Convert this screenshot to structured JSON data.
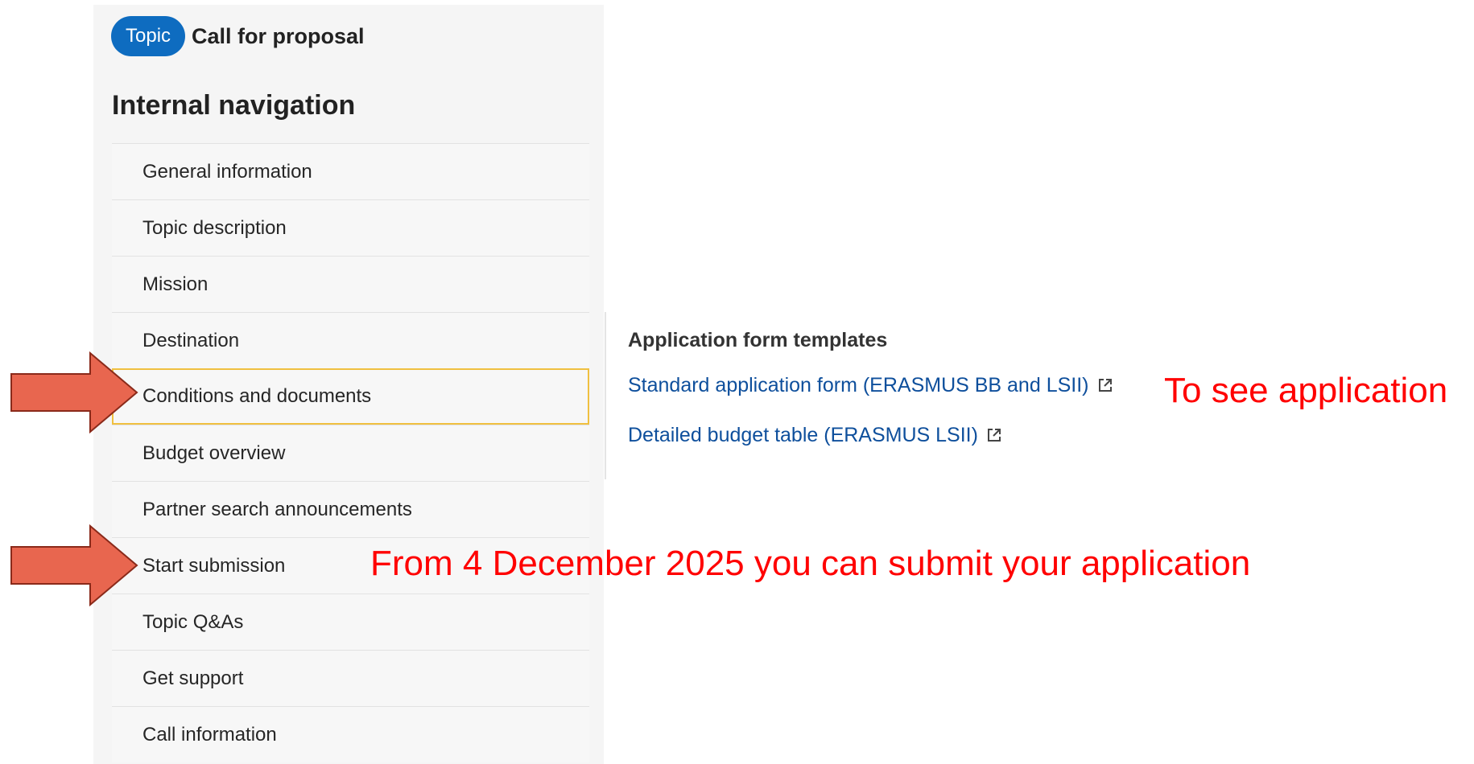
{
  "header": {
    "topic_badge": "Topic",
    "call_type": "Call for proposal"
  },
  "navigation": {
    "heading": "Internal navigation",
    "items": [
      {
        "label": "General information",
        "active": false
      },
      {
        "label": "Topic description",
        "active": false
      },
      {
        "label": "Mission",
        "active": false
      },
      {
        "label": "Destination",
        "active": false
      },
      {
        "label": "Conditions and documents",
        "active": true
      },
      {
        "label": "Budget overview",
        "active": false
      },
      {
        "label": "Partner search announcements",
        "active": false
      },
      {
        "label": "Start submission",
        "active": false
      },
      {
        "label": "Topic Q&As",
        "active": false
      },
      {
        "label": "Get support",
        "active": false
      },
      {
        "label": "Call information",
        "active": false
      }
    ]
  },
  "content": {
    "heading": "Application form templates",
    "links": [
      {
        "label": "Standard application form (ERASMUS BB and LSII)",
        "icon": "external-link-icon"
      },
      {
        "label": "Detailed budget table (ERASMUS LSII)",
        "icon": "external-link-icon"
      }
    ]
  },
  "annotations": {
    "application_note": "To see application",
    "submission_note": "From 4 December 2025 you can submit your application",
    "color": "#ff0000",
    "arrow_color": "#e8664f"
  },
  "colors": {
    "accent": "#0e6cc0",
    "link": "#0e4f9c",
    "active_border": "#f0c040"
  }
}
